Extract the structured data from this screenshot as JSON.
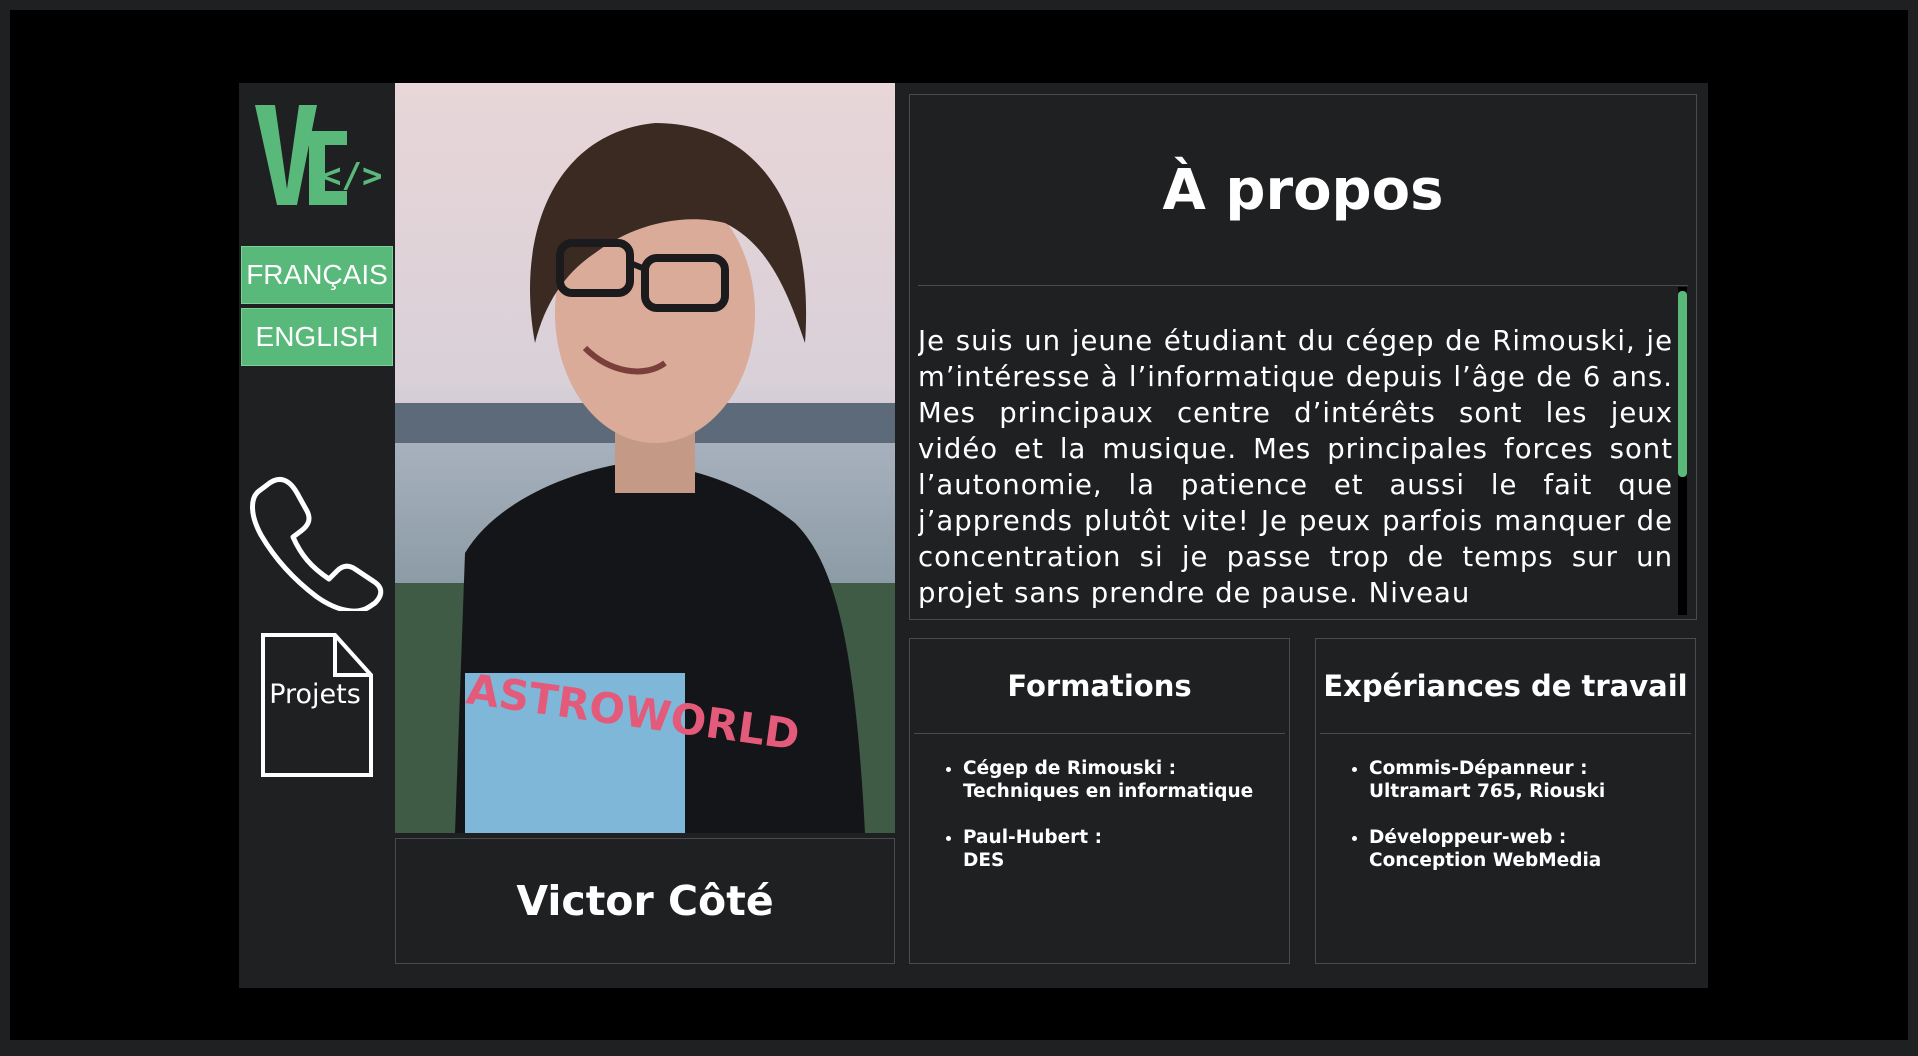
{
  "sidebar": {
    "logo": {
      "letters": "VC",
      "code_glyph": "</>"
    },
    "languages": [
      {
        "label": "FRANÇAIS"
      },
      {
        "label": "ENGLISH"
      }
    ],
    "projects_label": "Projets"
  },
  "profile": {
    "name": "Victor Côté"
  },
  "about": {
    "title": "À propos",
    "text": "Je suis un jeune étudiant du cégep de Rimouski, je m’intéresse à l’informatique depuis l’âge de 6 ans. Mes principaux centre d’intérêts sont les jeux vidéo et la musique. Mes principales forces sont l’autonomie, la patience et aussi le fait que j’apprends plutôt vite! Je peux parfois manquer de concentration si je passe trop de temps sur un projet sans prendre de pause. Niveau"
  },
  "formations": {
    "title": "Formations",
    "items": [
      {
        "line1": "Cégep de Rimouski :",
        "line2": "Techniques en informatique"
      },
      {
        "line1": "Paul-Hubert :",
        "line2": "DES"
      }
    ]
  },
  "experience": {
    "title": "Expériances de travail",
    "items": [
      {
        "line1": "Commis-Dépanneur :",
        "line2": "Ultramart 765, Riouski"
      },
      {
        "line1": "Développeur-web :",
        "line2": "Conception WebMedia"
      }
    ]
  },
  "colors": {
    "accent": "#59b97b",
    "panel": "#1f2022",
    "background": "#000000"
  },
  "icons": [
    "vc-logo-icon",
    "phone-icon",
    "document-icon"
  ]
}
